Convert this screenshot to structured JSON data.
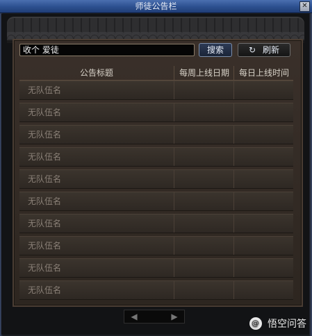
{
  "window": {
    "title": "师徒公告栏",
    "close_label": "✕"
  },
  "search": {
    "value": "收个 爱徒"
  },
  "buttons": {
    "search_label": "搜索",
    "refresh_label": "刷新",
    "refresh_icon": "↻"
  },
  "table": {
    "headers": [
      "公告标题",
      "每周上线日期",
      "每日上线时间"
    ],
    "rows": [
      [
        "无队伍名",
        "",
        ""
      ],
      [
        "无队伍名",
        "",
        ""
      ],
      [
        "无队伍名",
        "",
        ""
      ],
      [
        "无队伍名",
        "",
        ""
      ],
      [
        "无队伍名",
        "",
        ""
      ],
      [
        "无队伍名",
        "",
        ""
      ],
      [
        "无队伍名",
        "",
        ""
      ],
      [
        "无队伍名",
        "",
        ""
      ],
      [
        "无队伍名",
        "",
        ""
      ],
      [
        "无队伍名",
        "",
        ""
      ]
    ]
  },
  "pager": {
    "prev_label": "◀",
    "next_label": "▶"
  },
  "watermark": {
    "logo_text": "@",
    "text": "悟空问答"
  },
  "colors": {
    "title_bar": "#2c4f8f",
    "panel": "#3a302a",
    "row_text": "#8a8077"
  }
}
